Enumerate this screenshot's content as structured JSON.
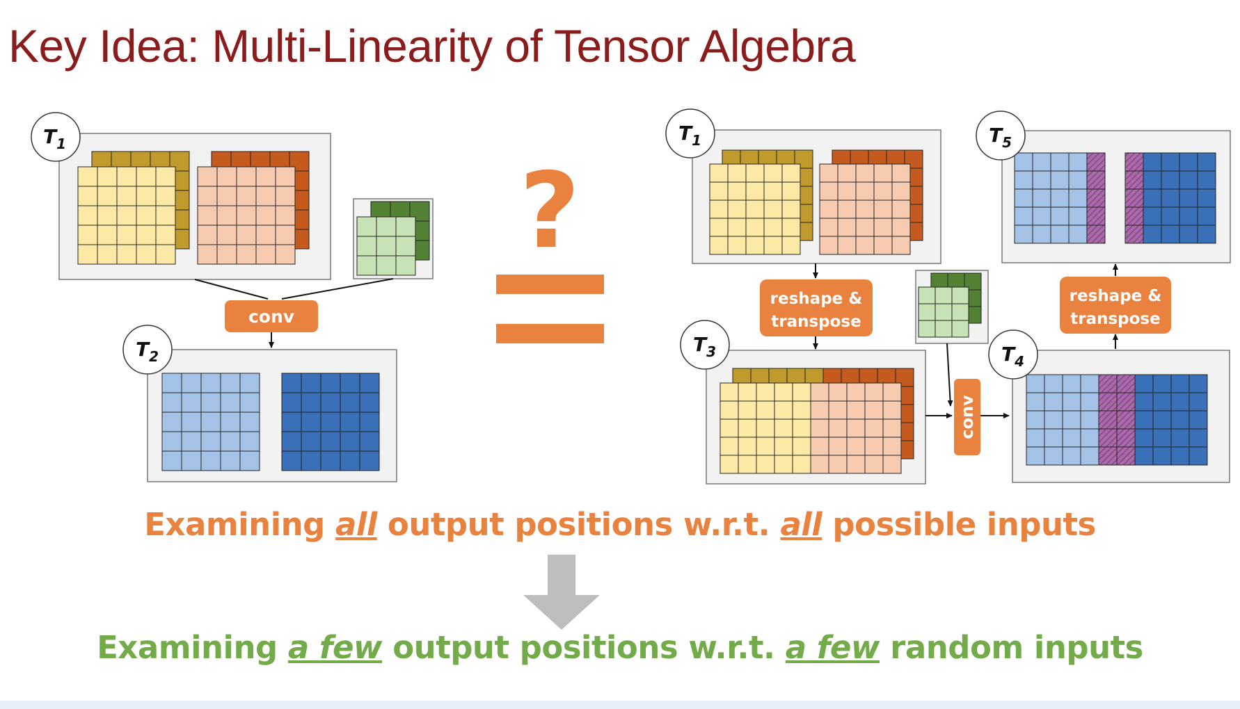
{
  "title": "Key Idea: Multi-Linearity of Tensor Algebra",
  "labels": {
    "t1": "T",
    "t1_sub": "1",
    "t2": "T",
    "t2_sub": "2",
    "t1b": "T",
    "t1b_sub": "1",
    "t3": "T",
    "t3_sub": "3",
    "t4": "T",
    "t4_sub": "4",
    "t5": "T",
    "t5_sub": "5"
  },
  "ops": {
    "conv_left": "conv",
    "reshape_top_1": "reshape &",
    "reshape_top_2": "transpose",
    "reshape_right_1": "reshape &",
    "reshape_right_2": "transpose",
    "conv_right": "conv"
  },
  "symbols": {
    "question": "?"
  },
  "line1": {
    "pre": "Examining ",
    "em1": "all",
    "mid": " output positions w.r.t. ",
    "em2": "all",
    "post": " possible inputs"
  },
  "line2": {
    "pre": "Examining ",
    "em1": "a few",
    "mid": " output positions w.r.t. ",
    "em2": "a few",
    "post": " random inputs"
  },
  "colors": {
    "title": "#8b1c1c",
    "orange": "#e8823e",
    "green_text": "#74ab4a",
    "yellow_fill": "#fce9a6",
    "yellow_back": "#c09a2c",
    "peach_fill": "#f7cbb0",
    "peach_back": "#c55a1e",
    "green_fill": "#c7e3b5",
    "green_back": "#548235",
    "light_blue": "#a4c2e6",
    "dark_blue": "#3a70b8",
    "hatch": "#a86aa8",
    "panel": "#f2f2f2"
  }
}
